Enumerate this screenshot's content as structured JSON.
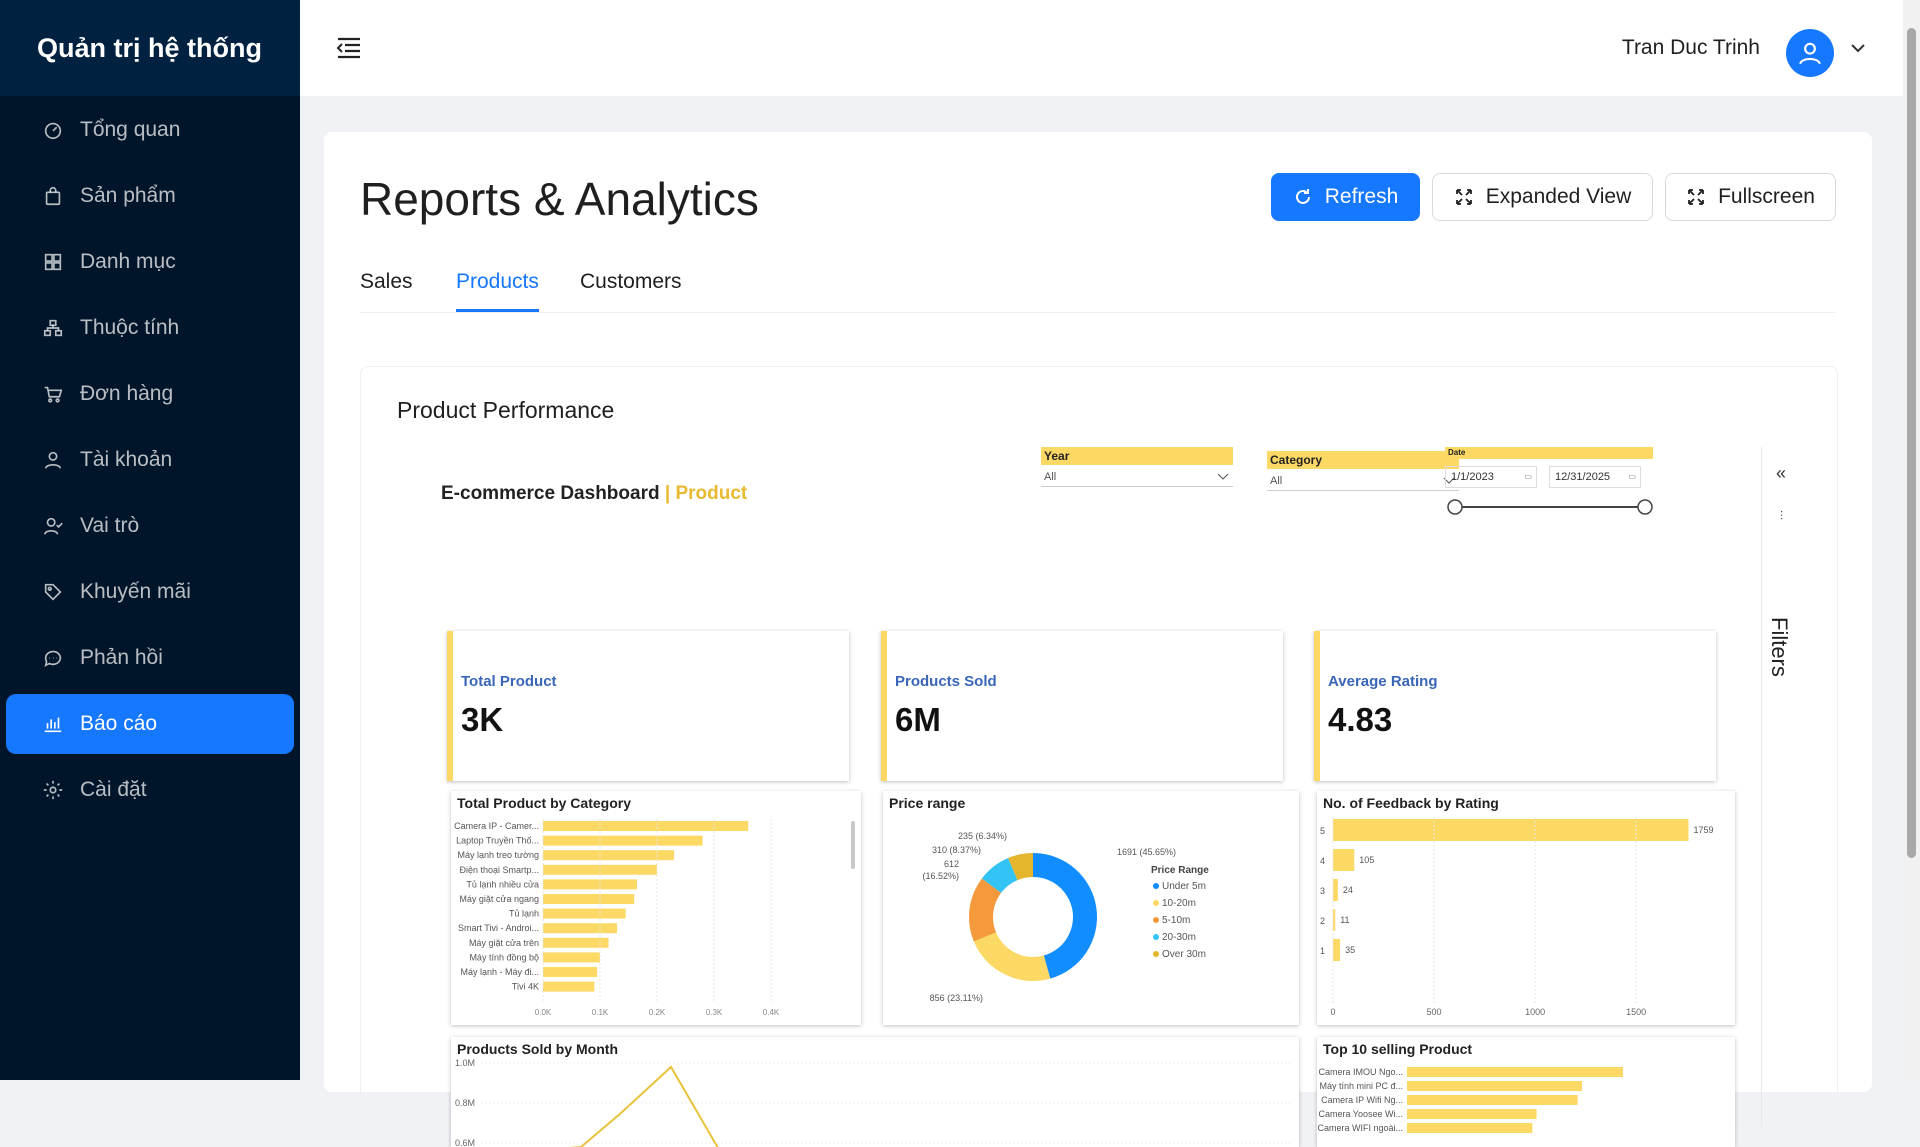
{
  "app": {
    "title": "Quản trị hệ thống"
  },
  "sidebar": {
    "items": [
      {
        "label": "Tổng quan",
        "icon": "dashboard-icon"
      },
      {
        "label": "Sản phẩm",
        "icon": "shopping-bag-icon"
      },
      {
        "label": "Danh mục",
        "icon": "grid-icon"
      },
      {
        "label": "Thuộc tính",
        "icon": "cluster-icon"
      },
      {
        "label": "Đơn hàng",
        "icon": "cart-icon"
      },
      {
        "label": "Tài khoản",
        "icon": "user-icon"
      },
      {
        "label": "Vai trò",
        "icon": "team-icon"
      },
      {
        "label": "Khuyến mãi",
        "icon": "tag-icon"
      },
      {
        "label": "Phản hồi",
        "icon": "message-icon"
      },
      {
        "label": "Báo cáo",
        "icon": "bar-chart-icon",
        "active": true
      },
      {
        "label": "Cài đặt",
        "icon": "gear-icon"
      }
    ]
  },
  "header": {
    "user_name": "Tran Duc Trinh"
  },
  "page": {
    "title": "Reports & Analytics",
    "buttons": {
      "refresh": "Refresh",
      "expanded": "Expanded View",
      "fullscreen": "Fullscreen"
    },
    "tabs": [
      "Sales",
      "Products",
      "Customers"
    ],
    "active_tab": "Products",
    "section_title": "Product Performance"
  },
  "report": {
    "title_main": "E-commerce Dashboard",
    "title_sep": "|",
    "title_accent": "Product",
    "slicers": {
      "year_label": "Year",
      "year_value": "All",
      "category_label": "Category",
      "category_value": "All",
      "date_label": "Date",
      "date_from": "1/1/2023",
      "date_to": "12/31/2025"
    },
    "kpis": [
      {
        "label": "Total Product",
        "value": "3K"
      },
      {
        "label": "Products Sold",
        "value": "6M"
      },
      {
        "label": "Average Rating",
        "value": "4.83"
      }
    ],
    "filters_label": "Filters",
    "accent_color": "#fcd865"
  },
  "chart_data": [
    {
      "type": "bar",
      "title": "Total Product by Category",
      "orientation": "horizontal",
      "categories": [
        "Camera IP - Camer...",
        "Laptop Truyền Thố...",
        "Máy lạnh treo tường",
        "Điện thoại Smartp...",
        "Tủ lạnh nhiều cửa",
        "Máy giặt cửa ngang",
        "Tủ lạnh",
        "Smart Tivi - Androi...",
        "Máy giặt cửa trên",
        "Máy tính đồng bộ",
        "Máy lạnh - Máy đi...",
        "Tivi 4K"
      ],
      "values": [
        0.36,
        0.28,
        0.23,
        0.2,
        0.165,
        0.16,
        0.145,
        0.13,
        0.115,
        0.1,
        0.095,
        0.09
      ],
      "ticks": [
        "0.0K",
        "0.1K",
        "0.2K",
        "0.3K",
        "0.4K"
      ],
      "xlim": [
        0,
        0.4
      ]
    },
    {
      "type": "pie",
      "title": "Price range",
      "legend_title": "Price Range",
      "labels": [
        "Under 5m",
        "10-20m",
        "5-10m",
        "20-30m",
        "Over 30m"
      ],
      "values": [
        1691,
        856,
        612,
        310,
        235
      ],
      "data_labels": [
        "1691 (45.65%)",
        "856 (23.11%)",
        "612 (16.52%)",
        "310 (8.37%)",
        "235 (6.34%)"
      ],
      "colors": [
        "#118dff",
        "#fcd865",
        "#f59a3c",
        "#34c3f5",
        "#e5b52c"
      ]
    },
    {
      "type": "bar",
      "title": "No. of Feedback by Rating",
      "orientation": "horizontal",
      "categories": [
        "5",
        "4",
        "3",
        "2",
        "1"
      ],
      "values": [
        1759,
        105,
        24,
        11,
        35
      ],
      "ticks": [
        "0",
        "500",
        "1000",
        "1500"
      ],
      "xlim": [
        0,
        1900
      ]
    },
    {
      "type": "line",
      "title": "Products Sold by Month",
      "yticks": [
        "1.0M",
        "0.8M",
        "0.6M"
      ],
      "series": [
        {
          "values": [
            0.55,
            0.58,
            0.75,
            0.98,
            0.55
          ]
        }
      ],
      "ylim": [
        0.55,
        1.0
      ]
    },
    {
      "type": "bar",
      "title": "Top 10 selling Product",
      "orientation": "horizontal",
      "categories": [
        "Camera IMOU Ngo...",
        "Máy tính mini PC đ...",
        "Camera IP Wifi Ng...",
        "Camera Yoosee Wi...",
        "Camera WIFI ngoài..."
      ],
      "values": [
        100,
        81,
        79,
        60,
        58
      ],
      "xlim": [
        0,
        100
      ]
    }
  ]
}
